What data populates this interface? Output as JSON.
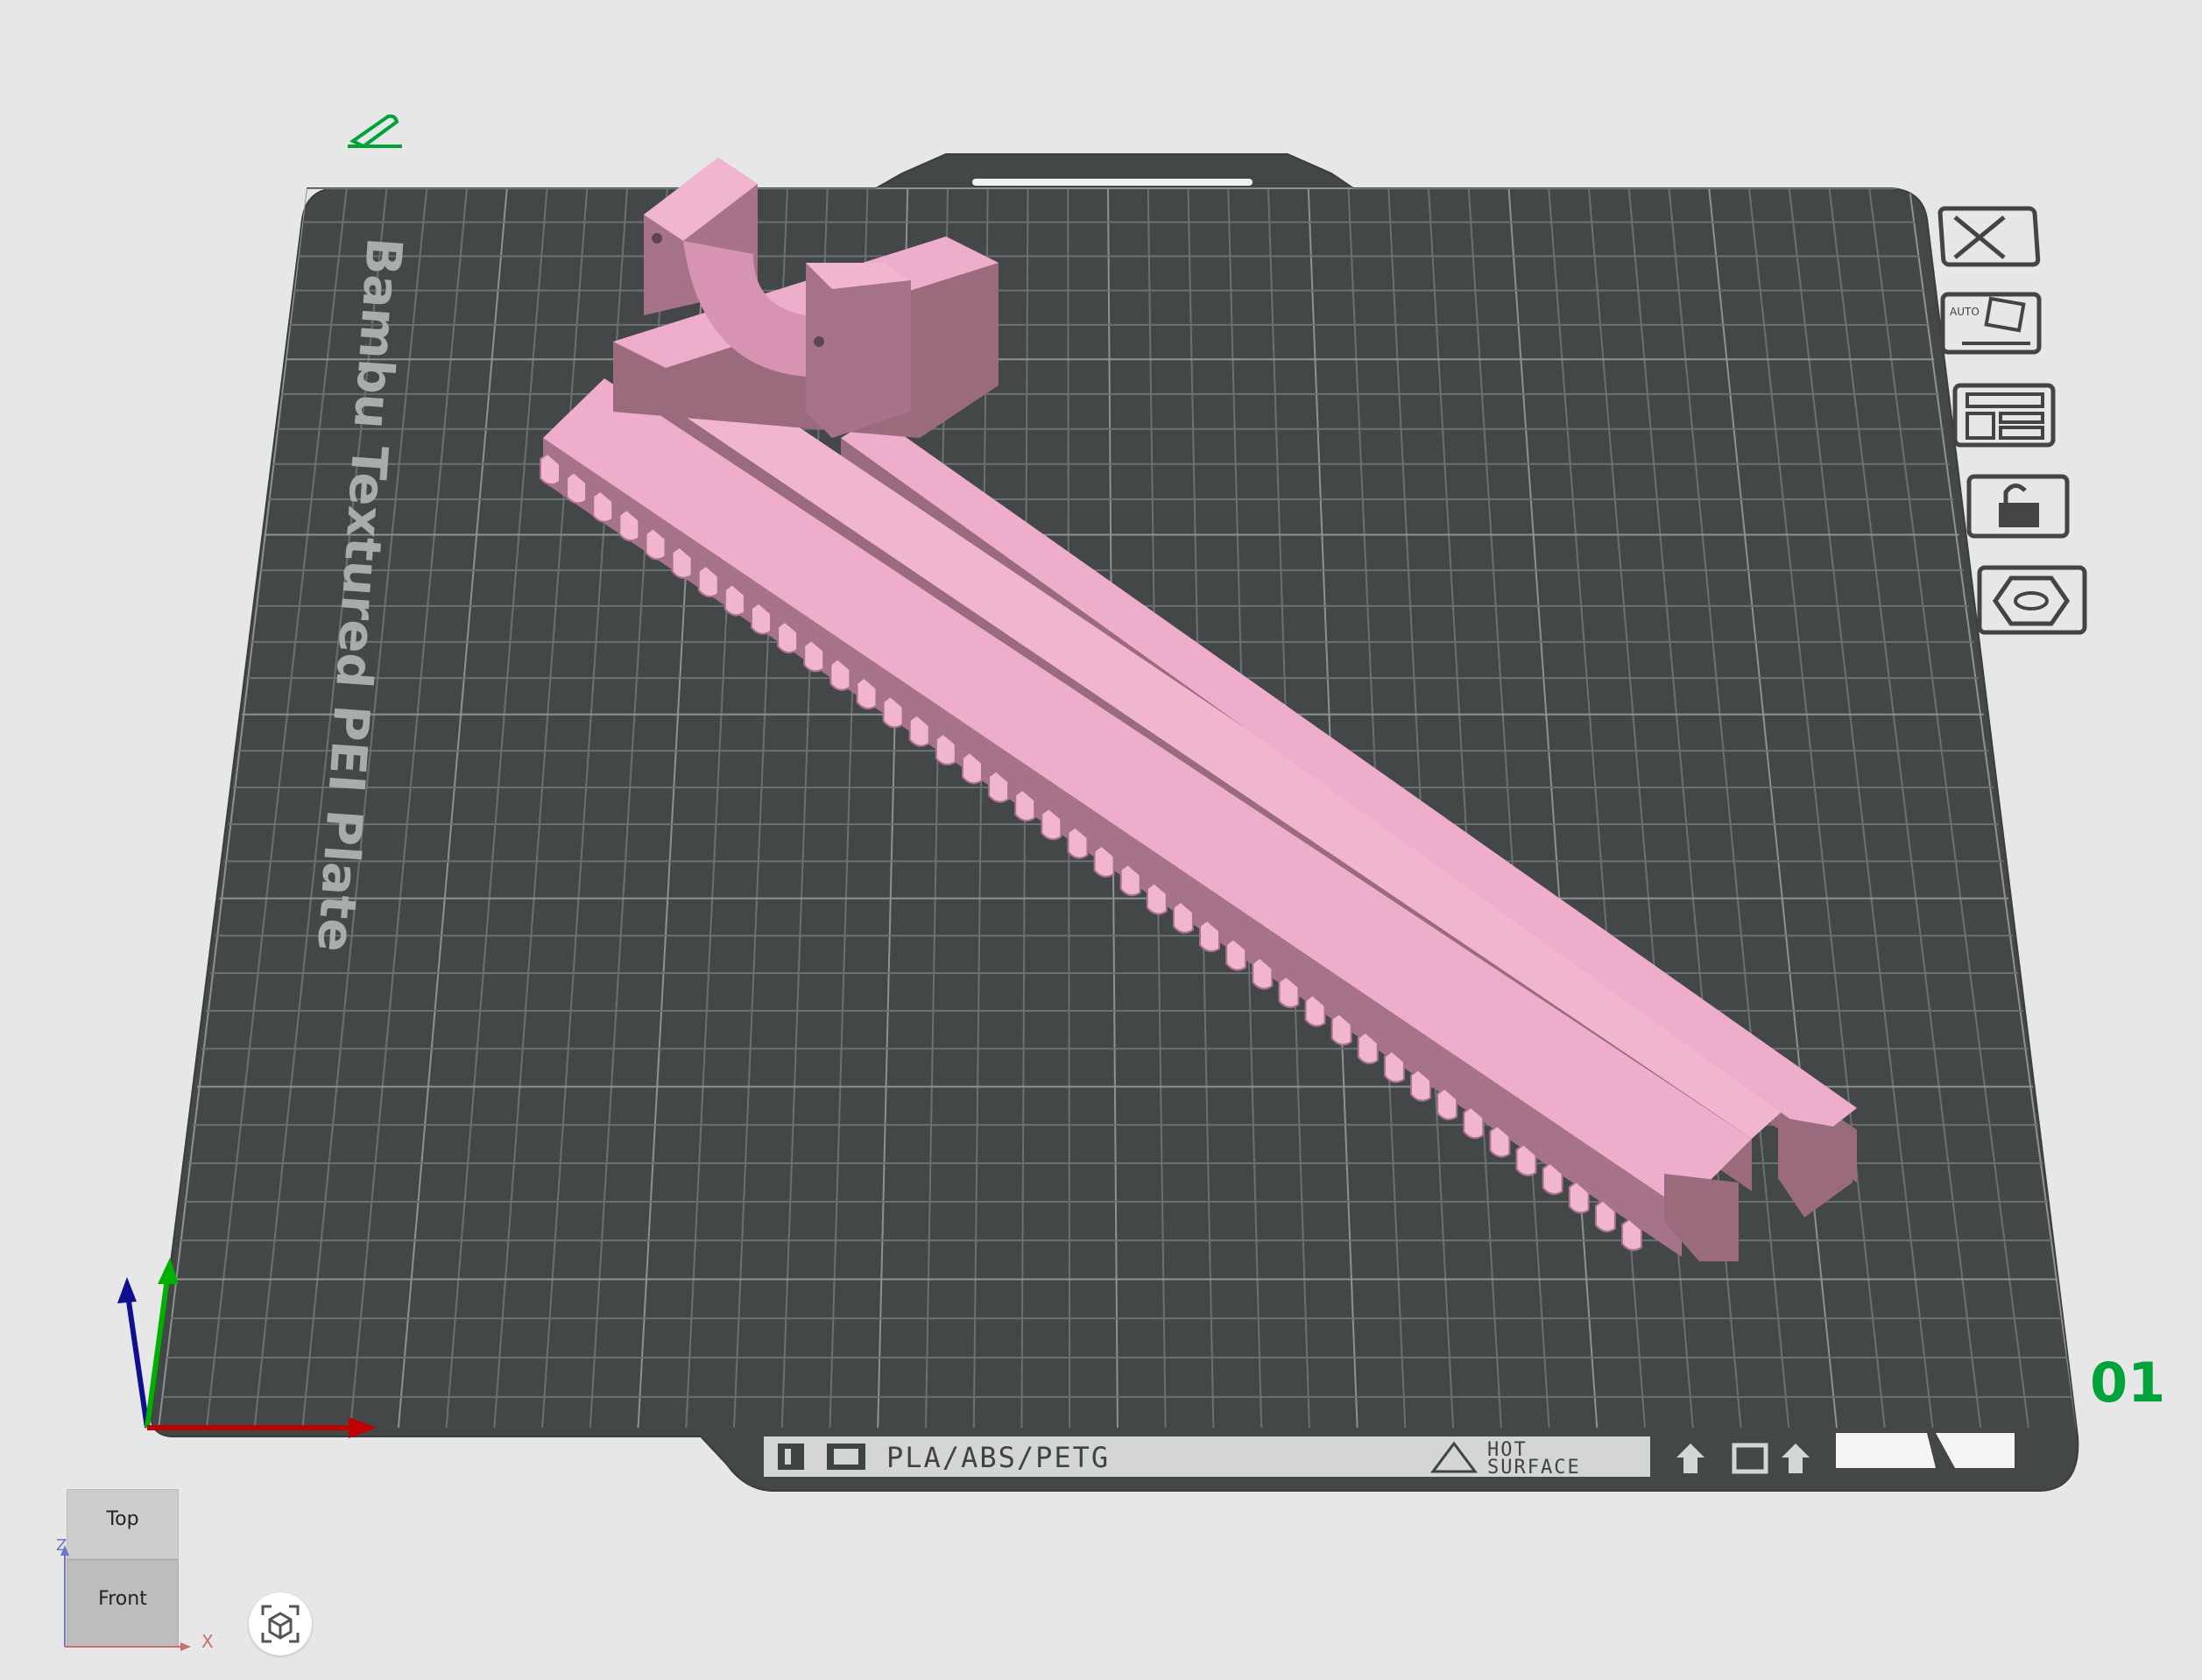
{
  "plate": {
    "name": "Bambu Textured PEI Plate",
    "material_label": "PLA/ABS/PETG",
    "hot_label_1": "HOT",
    "hot_label_2": "SURFACE",
    "plate_number": "01"
  },
  "toolbar": {
    "items": [
      {
        "icon": "close-icon"
      },
      {
        "icon": "auto-orient-icon",
        "label": "AUTO"
      },
      {
        "icon": "arrange-icon"
      },
      {
        "icon": "lock-icon"
      },
      {
        "icon": "settings-hex-icon"
      }
    ]
  },
  "view_cube": {
    "top_label": "Top",
    "front_label": "Front",
    "z_label": "Z",
    "x_label": "X"
  },
  "colors": {
    "background": "#e7e7e7",
    "plate": "#434747",
    "grid": "#6b7070",
    "model": "#eeadcb",
    "model_shadow": "#9a6a7d",
    "accent_green": "#00a33a"
  },
  "icons": {
    "edit": "pencil-edit-icon",
    "fit_view": "fit-view-icon"
  }
}
